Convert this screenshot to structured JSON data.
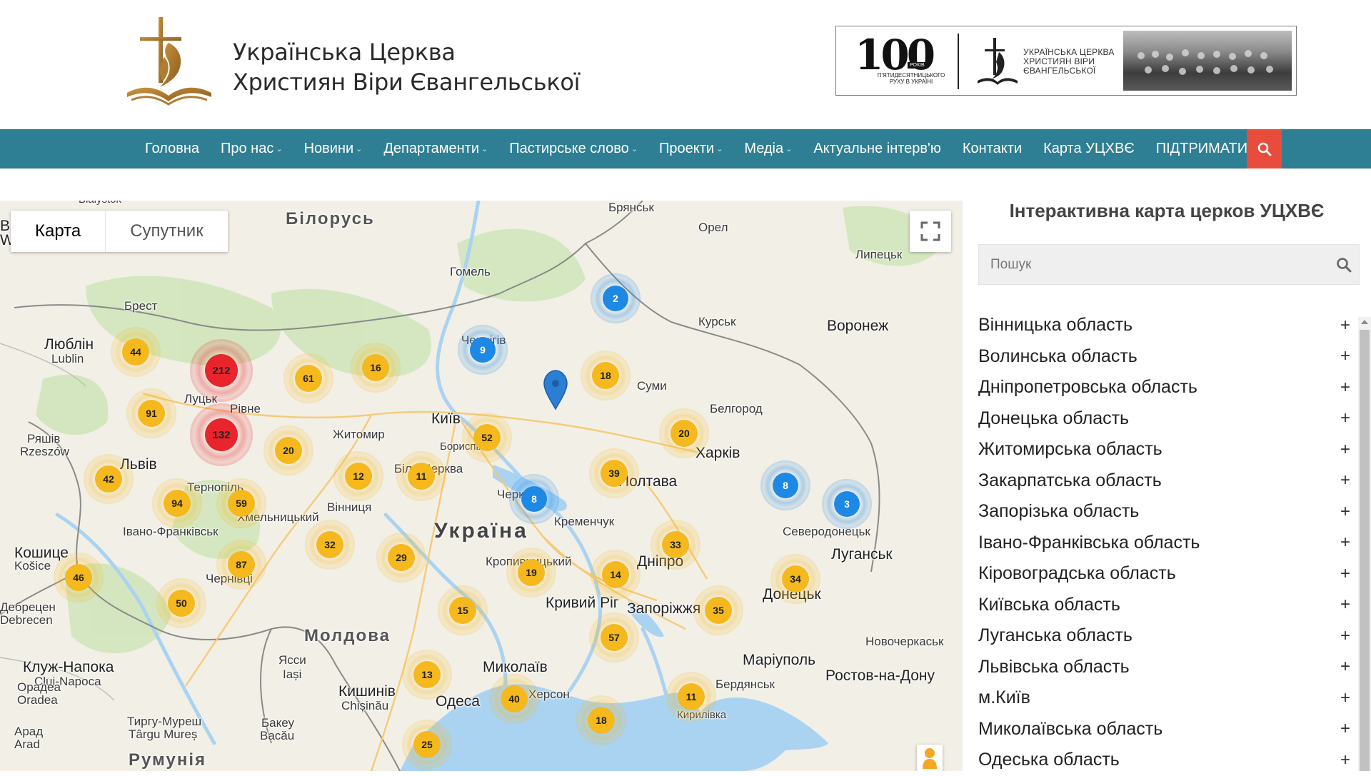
{
  "header": {
    "brand_line1": "Українська Церква",
    "brand_line2": "Християн Віри Євангельської",
    "banner": {
      "number": "100",
      "years_tag": "РОКІВ",
      "caption": "П'ЯТИДЕСЯТНИЦЬКОГО РУХУ В УКРАЇНІ",
      "org_line1": "УКРАЇНСЬКА ЦЕРКВА",
      "org_line2": "ХРИСТИЯН ВІРИ",
      "org_line3": "ЄВАНГЕЛЬСЬКОЇ"
    }
  },
  "nav": {
    "items": [
      {
        "label": "Головна",
        "dropdown": false
      },
      {
        "label": "Про нас",
        "dropdown": true
      },
      {
        "label": "Новини",
        "dropdown": true
      },
      {
        "label": "Департаменти",
        "dropdown": true
      },
      {
        "label": "Пастирське слово",
        "dropdown": true
      },
      {
        "label": "Проекти",
        "dropdown": true
      },
      {
        "label": "Медіа",
        "dropdown": true
      },
      {
        "label": "Актуальне інтерв'ю",
        "dropdown": false
      },
      {
        "label": "Контакти",
        "dropdown": false
      },
      {
        "label": "Карта УЦХВЄ",
        "dropdown": false
      },
      {
        "label": "ПІДТРИМАТИ",
        "dropdown": false
      }
    ],
    "search_icon": "search-icon",
    "search_color": "#e74c3c",
    "bar_color": "#2f7f94"
  },
  "map": {
    "tabs": [
      {
        "label": "Карта",
        "active": true
      },
      {
        "label": "Супутник",
        "active": false
      }
    ],
    "fullscreen_icon": "fullscreen-icon",
    "pegman_icon": "pegman-icon",
    "places": {
      "bilorus": "Білорусь",
      "ukraina": "Україна",
      "moldova": "Молдова",
      "rumunia": "Румунія",
      "bialystok": "Białystok",
      "varshava": "Варшава",
      "warszawa": "Warszawa",
      "brest": "Брест",
      "lublin_uk": "Люблін",
      "lublin": "Lublin",
      "lutsk": "Луцьк",
      "rivne": "Рівне",
      "zhytomyr": "Житомир",
      "kyiv": "Київ",
      "boryspil": "Бориспіль",
      "bila_tserkva": "Біла Церква",
      "chernihiv": "Чернігів",
      "gomel": "Гомель",
      "bryansk": "Брянськ",
      "orel": "Орел",
      "kursk": "Курськ",
      "voronezh": "Воронеж",
      "lipetsk": "Липецьк",
      "sumy": "Суми",
      "belgorod": "Белгород",
      "kharkiv": "Харків",
      "poltava": "Полтава",
      "cherkasy": "Черкаси",
      "kremenchuk": "Кременчук",
      "kropyvnytskyi": "Кропивницький",
      "dnipro": "Дніпро",
      "kryvyi_rih": "Кривий Ріг",
      "zaporizhzhia": "Запоріжжя",
      "donetsk": "Донецьк",
      "luhansk": "Луганськ",
      "sievierodonetsk": "Северодонецьк",
      "novocherkassk": "Новочеркаськ",
      "rostov": "Ростов-на-Дону",
      "mariupol": "Маріуполь",
      "berdiansk": "Бердянськ",
      "mykolaiv": "Миколаїв",
      "kherson": "Херсон",
      "odesa": "Одеса",
      "kyrylivka": "Кирилівка",
      "lviv": "Львів",
      "ternopil": "Тернопіль",
      "khmelnytskyi": "Хмельницький",
      "vinnytsia": "Вінниця",
      "ivano_frankivsk": "Івано-Франківськ",
      "chernivtsi": "Чернівці",
      "zheshuv": "Ряшів",
      "rzeszow": "Rzeszów",
      "koshytse": "Кошице",
      "kosice": "Košice",
      "debretsen": "Дебрецен",
      "debrecen": "Debrecen",
      "cluj_uk": "Клуж-Напока",
      "cluj": "Cluj-Napoca",
      "oradea_uk": "Орадеа",
      "oradea": "Oradea",
      "arad_uk": "Арад",
      "arad": "Arad",
      "tirgu_uk": "Тиргу-Муреш",
      "tirgu": "Târgu Mureș",
      "iasi_uk": "Ясси",
      "iasi": "Iași",
      "chisinau_uk": "Кишинів",
      "chisinau": "Chișinău",
      "bacau_uk": "Бакеу",
      "bacau": "Bacău"
    },
    "clusters": [
      {
        "count": "212",
        "level": "red"
      },
      {
        "count": "132",
        "level": "red"
      },
      {
        "count": "44",
        "level": "yellow"
      },
      {
        "count": "91",
        "level": "yellow"
      },
      {
        "count": "42",
        "level": "yellow"
      },
      {
        "count": "94",
        "level": "yellow"
      },
      {
        "count": "59",
        "level": "yellow"
      },
      {
        "count": "61",
        "level": "yellow"
      },
      {
        "count": "16",
        "level": "yellow"
      },
      {
        "count": "20",
        "level": "yellow"
      },
      {
        "count": "12",
        "level": "yellow"
      },
      {
        "count": "11",
        "level": "yellow"
      },
      {
        "count": "52",
        "level": "yellow"
      },
      {
        "count": "9",
        "level": "blue"
      },
      {
        "count": "2",
        "level": "blue"
      },
      {
        "count": "18",
        "level": "yellow"
      },
      {
        "count": "20",
        "level": "yellow"
      },
      {
        "count": "39",
        "level": "yellow"
      },
      {
        "count": "8",
        "level": "blue"
      },
      {
        "count": "8",
        "level": "blue"
      },
      {
        "count": "3",
        "level": "blue"
      },
      {
        "count": "32",
        "level": "yellow"
      },
      {
        "count": "29",
        "level": "yellow"
      },
      {
        "count": "87",
        "level": "yellow"
      },
      {
        "count": "46",
        "level": "yellow"
      },
      {
        "count": "50",
        "level": "yellow"
      },
      {
        "count": "19",
        "level": "yellow"
      },
      {
        "count": "14",
        "level": "yellow"
      },
      {
        "count": "33",
        "level": "yellow"
      },
      {
        "count": "34",
        "level": "yellow"
      },
      {
        "count": "15",
        "level": "yellow"
      },
      {
        "count": "57",
        "level": "yellow"
      },
      {
        "count": "35",
        "level": "yellow"
      },
      {
        "count": "13",
        "level": "yellow"
      },
      {
        "count": "40",
        "level": "yellow"
      },
      {
        "count": "18",
        "level": "yellow"
      },
      {
        "count": "11",
        "level": "yellow"
      },
      {
        "count": "25",
        "level": "yellow"
      }
    ],
    "colors": {
      "red": "#e8242c",
      "yellow": "#f5b81d",
      "blue": "#1e88e5",
      "water": "#aad3f2",
      "land": "#f2efe6",
      "forest": "#cfe5b9"
    }
  },
  "sidebar": {
    "title": "Інтерактивна карта церков УЦХВЄ",
    "search_placeholder": "Пошук",
    "search_icon": "search-icon",
    "regions": [
      "Вінницька область",
      "Волинська область",
      "Дніпропетровська область",
      "Донецька область",
      "Житомирська область",
      "Закарпатська область",
      "Запорізька область",
      "Івано-Франківська область",
      "Кіровоградська область",
      "Київська область",
      "Луганська область",
      "Львівська область",
      "м.Київ",
      "Миколаївська область",
      "Одеська область"
    ],
    "expand_symbol": "+"
  }
}
